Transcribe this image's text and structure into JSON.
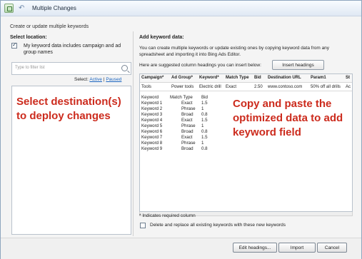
{
  "window": {
    "title": "Multiple Changes",
    "subtitle": "Create or update multiple keywords"
  },
  "left": {
    "select_location_label": "Select location:",
    "checkbox_checked": true,
    "checkbox_label": "My keyword data includes campaign and ad group names",
    "filter_placeholder": "Type to filter list",
    "select_label": "Select:",
    "select_active": "Active",
    "select_paused": "Paused",
    "overlay_text": "Select destination(s) to deploy changes"
  },
  "right": {
    "heading": "Add keyword data:",
    "description": "You can create multiple keywords or update existing ones by copying keyword data from any spreadsheet and importing it into Bing Ads Editor.",
    "suggest_text": "Here are suggested column headings you can insert below:",
    "insert_button": "Insert headings",
    "columns": [
      "Campaign*",
      "Ad Group*",
      "Keyword*",
      "Match Type",
      "Bid",
      "Destination URL",
      "Param1",
      "St"
    ],
    "sample_row": [
      "Tools",
      "Power tools",
      "Electric drill",
      "Exact",
      "2.50",
      "www.contoso.com",
      "50% off all drills",
      "Ac"
    ],
    "keyword_rows": [
      [
        "Keyword",
        "Match Type",
        "Bid"
      ],
      [
        "Keyword 1",
        "Exact",
        "1.5"
      ],
      [
        "Keyword 2",
        "Phrase",
        "1"
      ],
      [
        "Keyword 3",
        "Broad",
        "0.8"
      ],
      [
        "Keyword 4",
        "Exact",
        "1.5"
      ],
      [
        "Keyword 5",
        "Phrase",
        "1"
      ],
      [
        "Keyword 6",
        "Broad",
        "0.8"
      ],
      [
        "Keyword 7",
        "Exact",
        "1.5"
      ],
      [
        "Keyword 8",
        "Phrase",
        "1"
      ],
      [
        "Keyword 9",
        "Broad",
        "0.8"
      ]
    ],
    "overlay_text": "Copy and paste the optimized data to add keyword field",
    "required_note": "* Indicates required column",
    "replace_checked": false,
    "replace_label": "Delete and replace all existing keywords with these new keywords"
  },
  "footer": {
    "edit_headings": "Edit headings...",
    "import": "Import",
    "cancel": "Cancel"
  },
  "icons": {
    "app": "keyword-app-icon",
    "back": "back-arrow-icon",
    "search": "search-icon"
  },
  "colors": {
    "accent_link": "#1b65c0",
    "overlay_text": "#cc2b1d",
    "window_border": "#8fa6bf"
  }
}
